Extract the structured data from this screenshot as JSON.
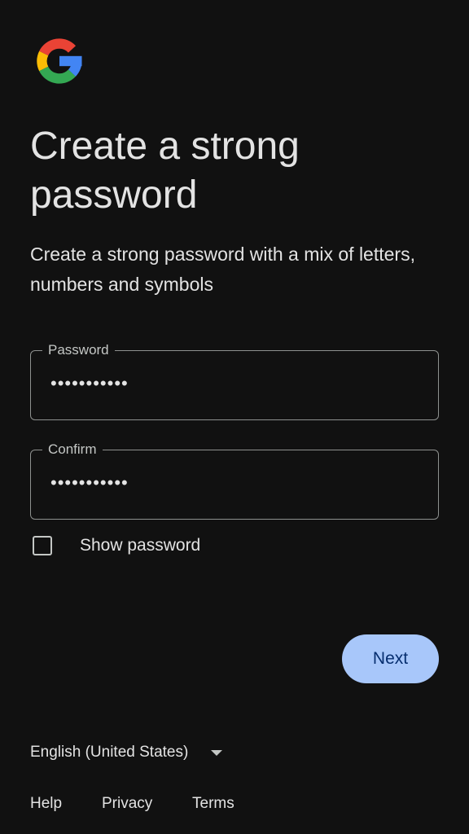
{
  "logo": {
    "icon": "google-g-icon",
    "colors": {
      "red": "#ea4335",
      "yellow": "#fbbc05",
      "green": "#34a853",
      "blue": "#4285f4"
    }
  },
  "heading": {
    "title": "Create a strong password",
    "subtitle": "Create a strong password with a mix of letters, numbers and symbols"
  },
  "form": {
    "password": {
      "label": "Password",
      "value": "•••••••••••"
    },
    "confirm": {
      "label": "Confirm",
      "value": "•••••••••••"
    },
    "show_password": {
      "label": "Show password",
      "checked": false
    }
  },
  "actions": {
    "next_label": "Next",
    "accent": "#a8c7fa"
  },
  "footer": {
    "language": "English (United States)",
    "links": [
      "Help",
      "Privacy",
      "Terms"
    ]
  }
}
